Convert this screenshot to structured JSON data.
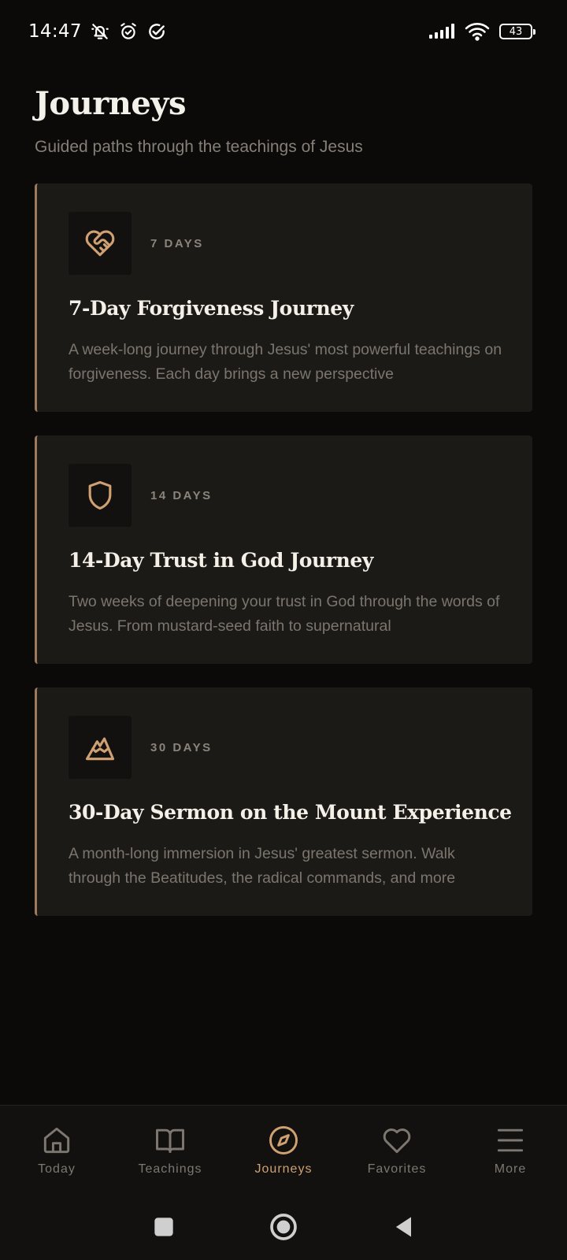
{
  "status_bar": {
    "time": "14:47",
    "battery": "43",
    "icons": [
      "mute-notifications-icon",
      "alarm-icon",
      "check-circle-icon",
      "signal-icon",
      "wifi-icon",
      "battery-icon"
    ]
  },
  "header": {
    "title": "Journeys",
    "subtitle": "Guided paths through the teachings of Jesus"
  },
  "journeys": [
    {
      "icon": "heart-handshake-icon",
      "days": "7 DAYS",
      "title": "7-Day Forgiveness Journey",
      "description": "A week-long journey through Jesus' most powerful teachings on forgiveness. Each day brings a new perspective"
    },
    {
      "icon": "shield-icon",
      "days": "14 DAYS",
      "title": "14-Day Trust in God Journey",
      "description": "Two weeks of deepening your trust in God through the words of Jesus. From mustard-seed faith to supernatural"
    },
    {
      "icon": "mountain-icon",
      "days": "30 DAYS",
      "title": "30-Day Sermon on the Mount Experience",
      "description": "A month-long immersion in Jesus' greatest sermon. Walk through the Beatitudes, the radical commands, and more"
    }
  ],
  "bottom_nav": {
    "items": [
      {
        "label": "Today",
        "icon": "home-icon",
        "active": false
      },
      {
        "label": "Teachings",
        "icon": "book-icon",
        "active": false
      },
      {
        "label": "Journeys",
        "icon": "compass-icon",
        "active": true
      },
      {
        "label": "Favorites",
        "icon": "heart-icon",
        "active": false
      },
      {
        "label": "More",
        "icon": "menu-icon",
        "active": false
      }
    ]
  },
  "system_nav": [
    "recents-button",
    "home-button",
    "back-button"
  ],
  "colors": {
    "background": "#0b0a09",
    "card": "#1c1a17",
    "accent": "#cfa172",
    "accent_border": "#9b7b5b",
    "muted_text": "#7b756d"
  }
}
